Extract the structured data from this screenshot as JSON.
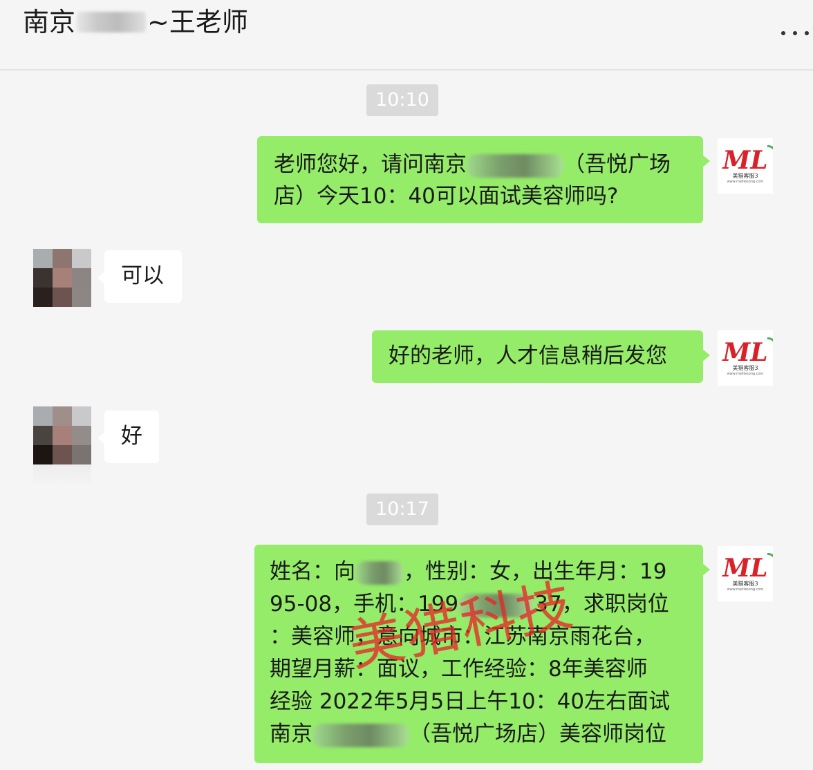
{
  "header": {
    "title_prefix": "南京",
    "title_suffix": "~王老师",
    "more_icon": "more-horizontal-icon"
  },
  "messages": [
    {
      "type": "time",
      "text": "10:10"
    },
    {
      "type": "out",
      "parts": [
        "老师您好，请问南京",
        "（吾悦广场",
        "店）今天10：40可以面试美容师吗?"
      ]
    },
    {
      "type": "in",
      "text": "可以"
    },
    {
      "type": "out",
      "text": "好的老师，人才信息稍后发您"
    },
    {
      "type": "in",
      "text": "好"
    },
    {
      "type": "time",
      "text": "10:17"
    },
    {
      "type": "out",
      "lines": [
        [
          "姓名：向",
          "，性别：女，出生年月：19"
        ],
        [
          "95-08，手机：199",
          "37，求职岗位"
        ],
        [
          "：美容师，意向城市：江苏南京雨花台，"
        ],
        [
          "期望月薪：面议，工作经验：8年美容师"
        ],
        [
          "经验 2022年5月5日上午10：40左右面试"
        ],
        [
          "南京",
          "（吾悦广场店）美容师岗位"
        ]
      ]
    }
  ],
  "logo": {
    "mark": "ML",
    "text": "美猎客服3",
    "sub": "www.meiliesong.com"
  },
  "watermark": "美猎科技",
  "colors": {
    "outgoing_bubble": "#95ec69",
    "incoming_bubble": "#ffffff",
    "background": "#f5f5f5",
    "watermark": "#e62828"
  }
}
